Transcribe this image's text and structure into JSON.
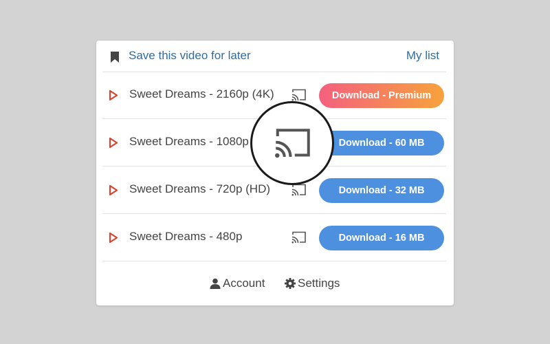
{
  "header": {
    "save_label": "Save this video for later",
    "mylist_label": "My list"
  },
  "icons": {
    "bookmark": "bookmark-icon",
    "play": "play-icon",
    "cast": "cast-icon",
    "account": "user-icon",
    "settings": "gear-icon"
  },
  "colors": {
    "link": "#2e6da4",
    "play": "#d9432f",
    "download_blue": "#4d90e0",
    "premium_start": "#f4607e",
    "premium_end": "#f7a23c"
  },
  "videos": [
    {
      "title": "Sweet Dreams - 2160p (4K)",
      "download_label": "Download - Premium",
      "premium": true
    },
    {
      "title": "Sweet Dreams - 1080p",
      "download_label": "Download - 60 MB",
      "premium": false
    },
    {
      "title": "Sweet Dreams - 720p (HD)",
      "download_label": "Download - 32 MB",
      "premium": false
    },
    {
      "title": "Sweet Dreams - 480p",
      "download_label": "Download - 16 MB",
      "premium": false
    }
  ],
  "footer": {
    "account_label": "Account",
    "settings_label": "Settings"
  }
}
